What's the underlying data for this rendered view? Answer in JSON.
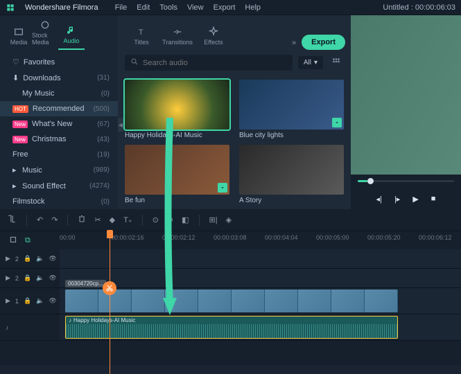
{
  "app": {
    "brand": "Wondershare Filmora",
    "title": "Untitled : 00:00:06:03"
  },
  "menu": [
    "File",
    "Edit",
    "Tools",
    "View",
    "Export",
    "Help"
  ],
  "mediaTabs": [
    {
      "id": "media",
      "label": "Media"
    },
    {
      "id": "stock",
      "label": "Stock Media"
    },
    {
      "id": "audio",
      "label": "Audio"
    },
    {
      "id": "titles",
      "label": "Titles"
    },
    {
      "id": "transitions",
      "label": "Transitions"
    },
    {
      "id": "effects",
      "label": "Effects"
    }
  ],
  "export_label": "Export",
  "search": {
    "placeholder": "Search audio"
  },
  "filter": {
    "label": "All"
  },
  "categories": [
    {
      "label": "Favorites",
      "count": "",
      "icon": "heart"
    },
    {
      "label": "Downloads",
      "count": "(31)",
      "icon": "download"
    },
    {
      "label": "My Music",
      "count": "(0)",
      "indent": true
    },
    {
      "label": "Recommended",
      "count": "(500)",
      "badge": "HOT",
      "badgeClass": "hot",
      "selected": true
    },
    {
      "label": "What's New",
      "count": "(67)",
      "badge": "New",
      "badgeClass": "new"
    },
    {
      "label": "Christmas",
      "count": "(43)",
      "badge": "New",
      "badgeClass": "new"
    },
    {
      "label": "Free",
      "count": "(19)"
    },
    {
      "label": "Music",
      "count": "(989)",
      "chev": true
    },
    {
      "label": "Sound Effect",
      "count": "(4274)",
      "chev": true
    },
    {
      "label": "Filmstock",
      "count": "(0)"
    }
  ],
  "thumbs": [
    {
      "cap": "Happy Holidays-AI Music",
      "sel": true,
      "bg": "radial-gradient(circle at 50% 60%,#ffcc3c,#3a5a2a 60%,#1a2a1a)"
    },
    {
      "cap": "Blue city lights",
      "dl": true,
      "bg": "linear-gradient(135deg,#1a3a5a,#3a5a8a)"
    },
    {
      "cap": "Be fun",
      "dl": true,
      "bg": "linear-gradient(135deg,#5a3a2a,#8a5a3a)"
    },
    {
      "cap": "A Story",
      "bg": "linear-gradient(135deg,#2a2a2a,#5a5a5a)"
    },
    {
      "cap": "",
      "bg": "linear-gradient(135deg,#3a2a1a,#6a4a2a)"
    },
    {
      "cap": "",
      "bg": "linear-gradient(135deg,#2a1a3a,#4a2a5a)"
    }
  ],
  "ruler": [
    "00:00",
    "00:00:02:16",
    "00:00:02:12",
    "00:00:03:08",
    "00:00:04:04",
    "00:00:05:00",
    "00:00:05:20",
    "00:00:06:12"
  ],
  "tracks": {
    "t2": {
      "label": "2"
    },
    "t2b": {
      "label": "2"
    },
    "t1": {
      "label": "1",
      "vidlabel": "00304720cp..."
    },
    "a": {
      "cliplabel": "Happy Holidays-AI Music"
    }
  }
}
